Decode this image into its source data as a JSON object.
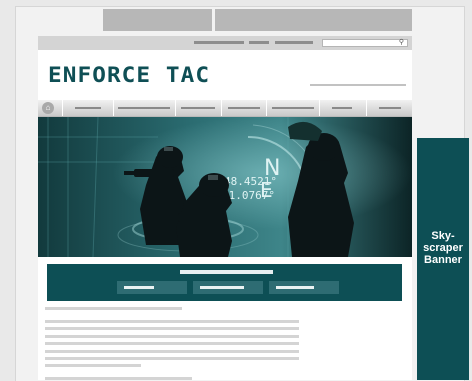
{
  "brand": {
    "logo_text": "ENFORCE TAC",
    "accent_color": "#0d4f55"
  },
  "ads": {
    "skyscraper_label": "Sky-\nscraper\nBanner"
  },
  "hero": {
    "coordinates_line1": "48.4521°",
    "coordinates_line2": "11.0767°",
    "compass_n": "N",
    "compass_e": "E"
  },
  "icons": {
    "search": "search-icon",
    "home": "home-icon"
  }
}
